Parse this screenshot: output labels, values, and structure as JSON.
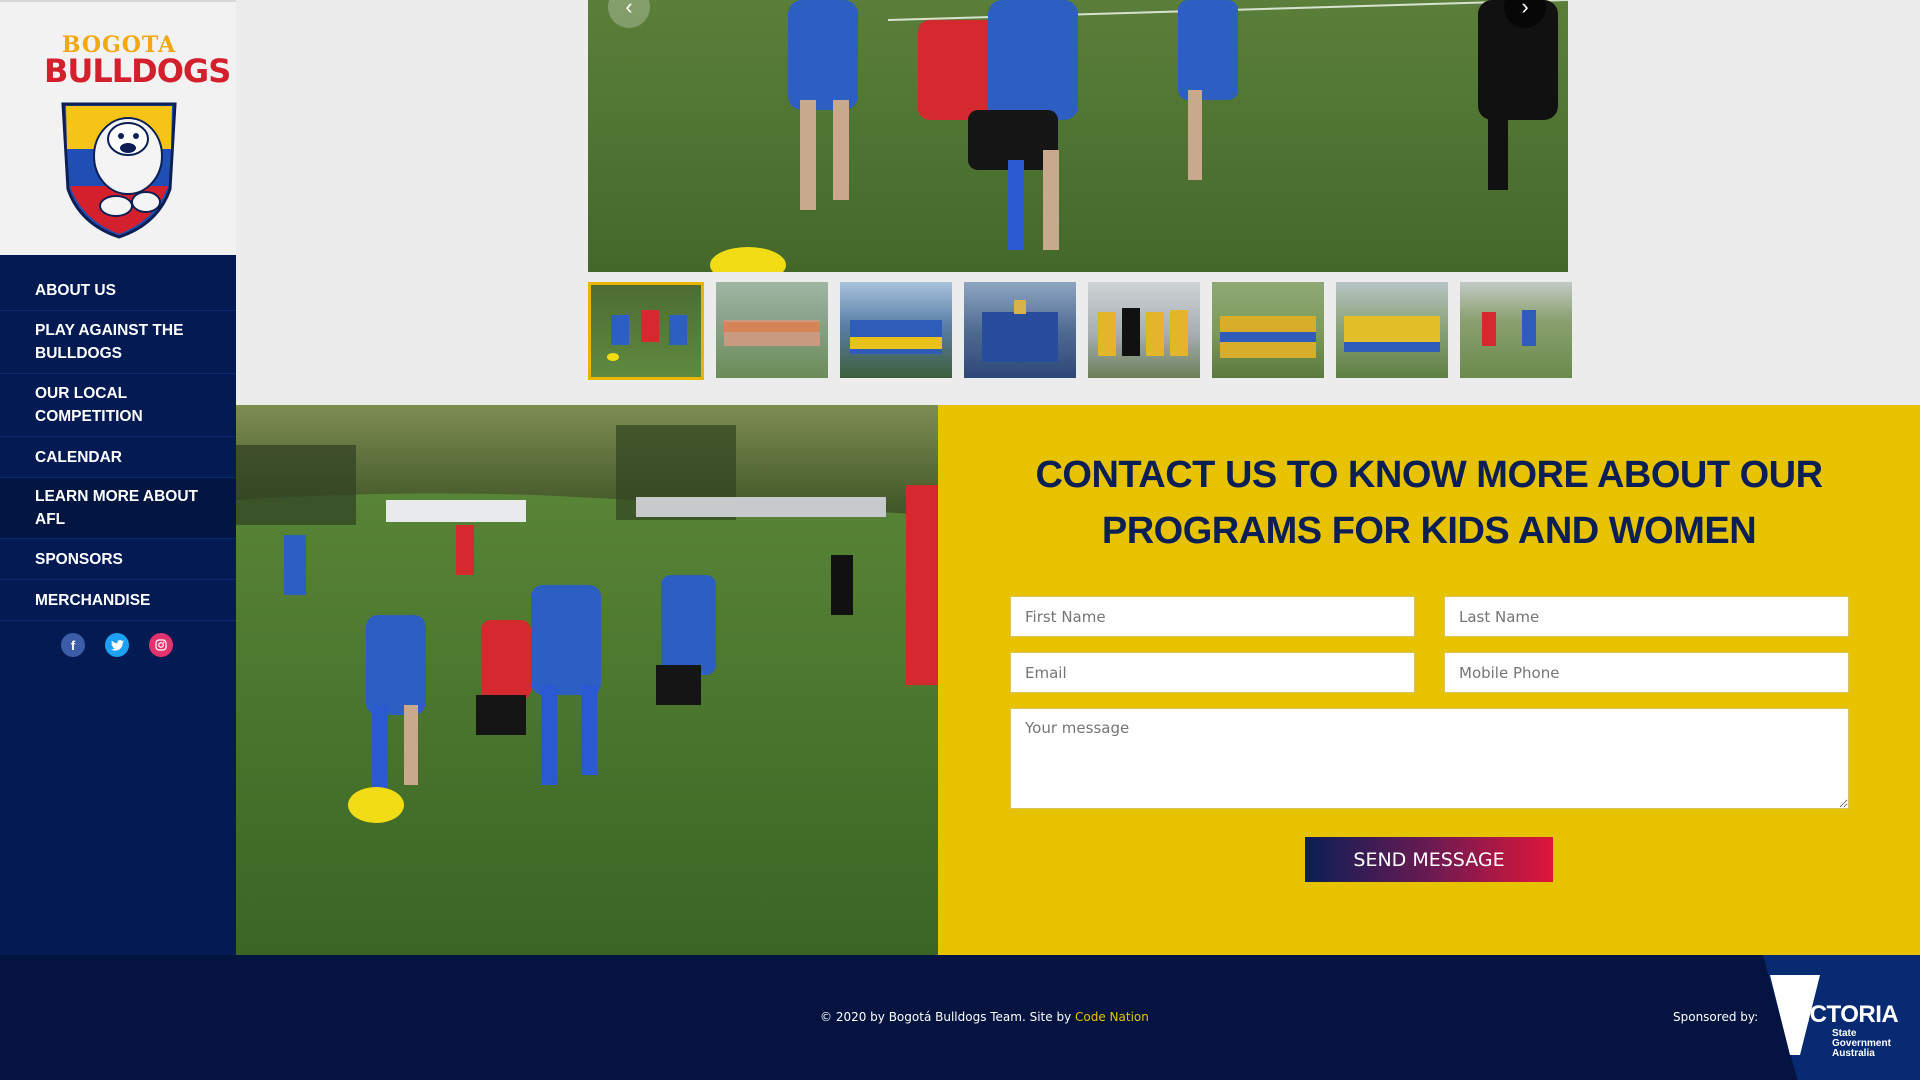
{
  "brand": {
    "logo_line1": "BOGOTA",
    "logo_line2": "BULLDOGS"
  },
  "nav": {
    "items": [
      {
        "label": "ABOUT US"
      },
      {
        "label": "PLAY AGAINST THE BULLDOGS"
      },
      {
        "label": "OUR LOCAL COMPETITION"
      },
      {
        "label": "CALENDAR"
      },
      {
        "label": "LEARN MORE ABOUT AFL"
      },
      {
        "label": "SPONSORS"
      },
      {
        "label": "MERCHANDISE"
      }
    ],
    "active_index": 4
  },
  "socials": {
    "facebook_icon": "f",
    "twitter_icon": "t",
    "instagram_icon": "ig"
  },
  "gallery": {
    "prev_icon": "‹",
    "next_icon": "›"
  },
  "contact": {
    "title": "CONTACT US TO KNOW MORE ABOUT OUR PROGRAMS FOR KIDS AND WOMEN",
    "first_name_placeholder": "First Name",
    "last_name_placeholder": "Last Name",
    "email_placeholder": "Email",
    "phone_placeholder": "Mobile Phone",
    "message_placeholder": "Your message",
    "send_label": "SEND MESSAGE"
  },
  "footer": {
    "copyright": "© 2020 by Bogotá Bulldogs Team. Site by ",
    "site_by_link": "Code Nation",
    "sponsored_by": "Sponsored by:",
    "sponsor_name": "VICTORIA",
    "sponsor_line1": "State",
    "sponsor_line2": "Government",
    "sponsor_line3": "Australia"
  },
  "colors": {
    "navy": "#041a52",
    "yellow": "#e7c200",
    "red": "#e0163a"
  }
}
